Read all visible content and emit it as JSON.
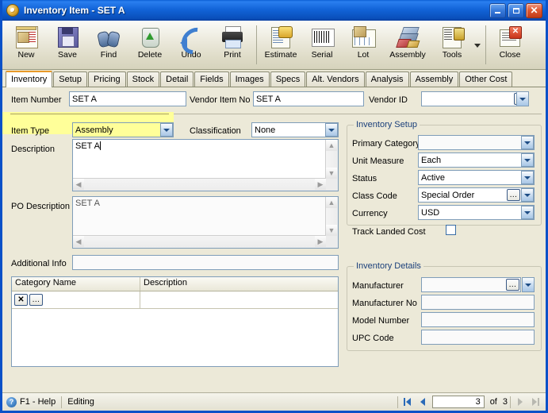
{
  "window": {
    "title_main": "Inventory Item",
    "title_sep": " - ",
    "title_item": "SET A",
    "minimize_label": "_",
    "maximize_label": "□",
    "close_label": "✕"
  },
  "toolbar": {
    "items": [
      {
        "label": "New",
        "icon": "new-document-icon"
      },
      {
        "label": "Save",
        "icon": "floppy-disk-icon"
      },
      {
        "label": "Find",
        "icon": "binoculars-icon"
      },
      {
        "label": "Delete",
        "icon": "recycle-bin-icon"
      },
      {
        "label": "Undo",
        "icon": "undo-arrow-icon"
      },
      {
        "label": "Print",
        "icon": "printer-icon"
      },
      {
        "label": "Estimate",
        "icon": "estimate-icon"
      },
      {
        "label": "Serial",
        "icon": "barcode-icon"
      },
      {
        "label": "Lot",
        "icon": "lot-icon"
      },
      {
        "label": "Assembly",
        "icon": "assembly-icon"
      },
      {
        "label": "Tools",
        "icon": "tools-icon"
      },
      {
        "label": "Close",
        "icon": "close-document-icon"
      }
    ]
  },
  "tabs": {
    "active": "Inventory",
    "items": [
      "Inventory",
      "Setup",
      "Pricing",
      "Stock",
      "Detail",
      "Fields",
      "Images",
      "Specs",
      "Alt. Vendors",
      "Analysis",
      "Assembly",
      "Other Cost"
    ]
  },
  "form": {
    "item_number": {
      "label": "Item Number",
      "value": "SET A"
    },
    "vendor_item_no": {
      "label": "Vendor Item No",
      "value": "SET A"
    },
    "vendor_id": {
      "label": "Vendor ID",
      "value": "",
      "ellipsis": "…"
    },
    "item_type": {
      "label": "Item Type",
      "value": "Assembly",
      "highlight_color": "#ffff99"
    },
    "classification": {
      "label": "Classification",
      "value": "None"
    },
    "description": {
      "label": "Description",
      "value": "SET A"
    },
    "po_description": {
      "label": "PO Description",
      "value": "SET A"
    },
    "additional_info": {
      "label": "Additional Info",
      "value": ""
    }
  },
  "inventory_setup": {
    "title": "Inventory Setup",
    "primary_category": {
      "label": "Primary Category",
      "value": ""
    },
    "unit_measure": {
      "label": "Unit Measure",
      "value": "Each"
    },
    "status": {
      "label": "Status",
      "value": "Active"
    },
    "class_code": {
      "label": "Class Code",
      "value": "Special Order",
      "ellipsis": "…"
    },
    "currency": {
      "label": "Currency",
      "value": "USD"
    },
    "track_landed_cost": {
      "label": "Track Landed Cost",
      "checked": false
    }
  },
  "inventory_details": {
    "title": "Inventory Details",
    "manufacturer": {
      "label": "Manufacturer",
      "value": "",
      "ellipsis": "…"
    },
    "manufacturer_no": {
      "label": "Manufacturer No",
      "value": ""
    },
    "model_number": {
      "label": "Model Number",
      "value": ""
    },
    "upc_code": {
      "label": "UPC Code",
      "value": ""
    }
  },
  "category_grid": {
    "columns": [
      "Category Name",
      "Description"
    ],
    "rows": [
      {
        "delete_label": "✕",
        "lookup_label": "…",
        "category_name": "",
        "description": ""
      }
    ]
  },
  "statusbar": {
    "help_icon_label": "?",
    "help_text": "F1 - Help",
    "mode": "Editing",
    "record_current": "3",
    "record_of": "of",
    "record_total": "3"
  }
}
